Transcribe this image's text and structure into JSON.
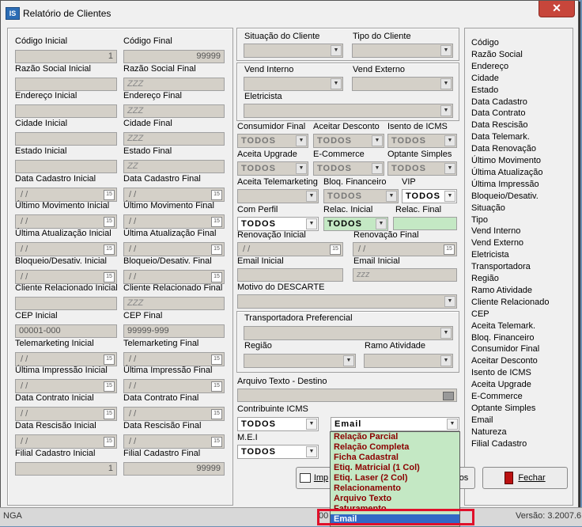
{
  "window": {
    "title": "Relatório de Clientes",
    "icon": "app-icon",
    "icon_text": "IS",
    "close": "✕"
  },
  "left": {
    "codigo_inicial": {
      "label": "Código Inicial",
      "value": "1"
    },
    "codigo_final": {
      "label": "Código Final",
      "value": "99999"
    },
    "razao_inicial": {
      "label": "Razão Social Inicial",
      "value": ""
    },
    "razao_final": {
      "label": "Razão Social Final",
      "value": "ZZZ"
    },
    "endereco_inicial": {
      "label": "Endereço Inicial",
      "value": ""
    },
    "endereco_final": {
      "label": "Endereço Final",
      "value": "ZZZ"
    },
    "cidade_inicial": {
      "label": "Cidade Inicial",
      "value": ""
    },
    "cidade_final": {
      "label": "Cidade Final",
      "value": "ZZZ"
    },
    "estado_inicial": {
      "label": "Estado Inicial",
      "value": ""
    },
    "estado_final": {
      "label": "Estado Final",
      "value": "ZZ"
    },
    "cadastro_inicial": {
      "label": "Data Cadastro Inicial",
      "value": "/  /"
    },
    "cadastro_final": {
      "label": "Data Cadastro Final",
      "value": "/  /"
    },
    "movimento_inicial": {
      "label": "Último Movimento Inicial",
      "value": "/  /"
    },
    "movimento_final": {
      "label": "Último Movimento Final",
      "value": "/  /"
    },
    "atualizacao_inicial": {
      "label": "Última Atualização Inicial",
      "value": "/  /"
    },
    "atualizacao_final": {
      "label": "Última Atualização Final",
      "value": "/  /"
    },
    "bloqueio_inicial": {
      "label": "Bloqueio/Desativ. Inicial",
      "value": "/  /"
    },
    "bloqueio_final": {
      "label": "Bloqueio/Desativ. Final",
      "value": "/  /"
    },
    "relacionado_inicial": {
      "label": "Cliente Relacionado Inicial",
      "value": ""
    },
    "relacionado_final": {
      "label": "Cliente Relacionado Final",
      "value": "ZZZ"
    },
    "cep_inicial": {
      "label": "CEP Inicial",
      "value": "00001-000"
    },
    "cep_final": {
      "label": "CEP Final",
      "value": "99999-999"
    },
    "telemarketing_inicial": {
      "label": "Telemarketing Inicial",
      "value": "/  /"
    },
    "telemarketing_final": {
      "label": "Telemarketing Final",
      "value": "/  /"
    },
    "impressao_inicial": {
      "label": "Última Impressão Inicial",
      "value": "/  /"
    },
    "impressao_final": {
      "label": "Última Impressão Final",
      "value": "/  /"
    },
    "contrato_inicial": {
      "label": "Data Contrato Inicial",
      "value": "/  /"
    },
    "contrato_final": {
      "label": "Data Contrato Final",
      "value": "/  /"
    },
    "rescisao_inicial": {
      "label": "Data Rescisão Inicial",
      "value": "/  /"
    },
    "rescisao_final": {
      "label": "Data Rescisão Final",
      "value": "/  /"
    },
    "filial_inicial": {
      "label": "Filial Cadastro Inicial",
      "value": "1"
    },
    "filial_final": {
      "label": "Filial Cadastro Final",
      "value": "99999"
    }
  },
  "middle": {
    "situacao": {
      "label": "Situação do Cliente",
      "value": ""
    },
    "tipo": {
      "label": "Tipo do Cliente",
      "value": ""
    },
    "vend_interno": {
      "label": "Vend Interno",
      "value": ""
    },
    "vend_externo": {
      "label": "Vend Externo",
      "value": ""
    },
    "eletricista": {
      "label": "Eletricista",
      "value": ""
    },
    "consumidor_final": {
      "label": "Consumidor Final",
      "value": "TODOS"
    },
    "aceitar_desconto": {
      "label": "Aceitar Desconto",
      "value": "TODOS"
    },
    "isento_icms": {
      "label": "Isento de ICMS",
      "value": "TODOS"
    },
    "aceita_upgrade": {
      "label": "Aceita Upgrade",
      "value": "TODOS"
    },
    "ecommerce": {
      "label": "E-Commerce",
      "value": "TODOS"
    },
    "optante_simples": {
      "label": "Optante Simples",
      "value": "TODOS"
    },
    "aceita_telemarketing": {
      "label": "Aceita Telemarketing",
      "value": ""
    },
    "bloq_financeiro": {
      "label": "Bloq. Financeiro",
      "value": "TODOS"
    },
    "vip": {
      "label": "VIP",
      "value": "TODOS"
    },
    "com_perfil": {
      "label": "Com Perfil",
      "value": "TODOS"
    },
    "relac_inicial": {
      "label": "Relac. Inicial",
      "value": "TODOS"
    },
    "relac_final": {
      "label": "Relac. Final",
      "value": ""
    },
    "renovacao_inicial": {
      "label": "Renovação Inicial",
      "value": "/  /"
    },
    "renovacao_final": {
      "label": "Renovação Final",
      "value": "/  /"
    },
    "email_inicial": {
      "label": "Email Inicial",
      "value": ""
    },
    "email_final": {
      "label": "Email Inicial",
      "value": "zzz"
    },
    "motivo_descarte": {
      "label": "Motivo do DESCARTE",
      "value": ""
    },
    "transportadora": {
      "label": "Transportadora Preferencial",
      "value": ""
    },
    "regiao": {
      "label": "Região",
      "value": ""
    },
    "ramo": {
      "label": "Ramo Atividade",
      "value": ""
    },
    "arquivo_texto": {
      "label": "Arquivo Texto - Destino",
      "value": ""
    },
    "contribuinte_icms": {
      "label": "Contribuinte ICMS",
      "value": "TODOS"
    },
    "mei": {
      "label": "M.E.I",
      "value": "TODOS"
    },
    "output_type": {
      "value": "Email"
    }
  },
  "dropdown": {
    "options": [
      "Relação Parcial",
      "Relação Completa",
      "Ficha Cadastral",
      "Etiq. Matricial (1 Col)",
      "Etiq. Laser (2 Col)",
      "Relacionamento",
      "Arquivo Texto",
      "Faturamento",
      "Email"
    ],
    "selected": "Email"
  },
  "buttons": {
    "imprimir": "Imp",
    "todos_partial": "os",
    "fechar": "Fechar"
  },
  "right_list": [
    "Código",
    "Razão Social",
    "Endereço",
    "Cidade",
    "Estado",
    "Data Cadastro",
    "Data Contrato",
    "Data Rescisão",
    "Data Telemark.",
    "Data Renovação",
    "Último Movimento",
    "Última Atualização",
    "Última Impressão",
    "Bloqueio/Desativ.",
    "Situação",
    "Tipo",
    "Vend Interno",
    "Vend Externo",
    "Eletricista",
    "Transportadora",
    "Região",
    "Ramo Atividade",
    "Cliente Relacionado",
    "CEP",
    "Aceita Telemark.",
    "Bloq. Financeiro",
    "Consumidor Final",
    "Aceitar Desconto",
    "Isento de ICMS",
    "Aceita Upgrade",
    "E-Commerce",
    "Optante Simples",
    "Email",
    "Natureza",
    "Filial Cadastro"
  ],
  "statusbar": {
    "left": "NGA",
    "middle": "00",
    "version": "Versão: 3.2007.6"
  },
  "colors": {
    "highlight": "#e0102a",
    "selected": "#3169c6",
    "dropdown_bg": "#c4e8c4",
    "option_text": "#8b0000"
  }
}
